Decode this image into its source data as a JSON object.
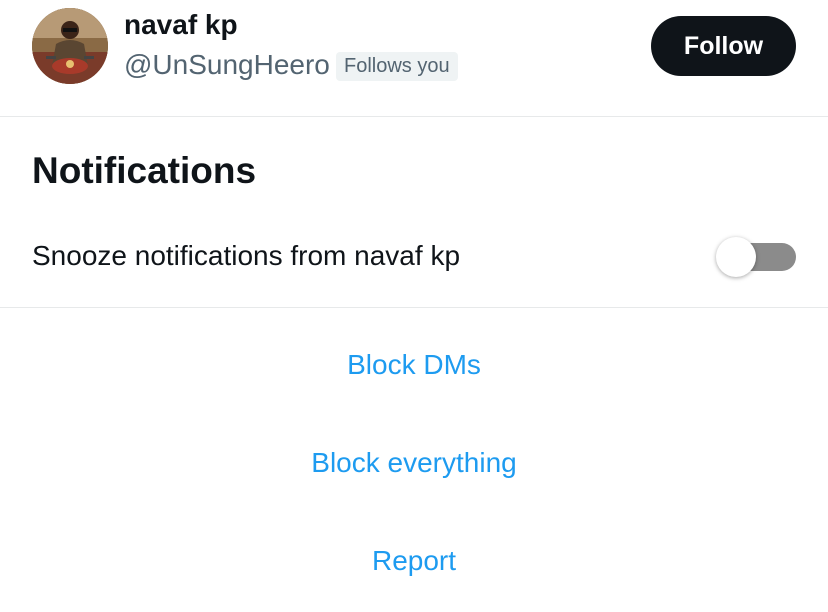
{
  "profile": {
    "name": "navaf kp",
    "handle": "@UnSungHeero",
    "follows_badge": "Follows you",
    "follow_label": "Follow"
  },
  "notifications": {
    "title": "Notifications",
    "snooze_label": "Snooze notifications from navaf kp",
    "snooze_enabled": false
  },
  "actions": {
    "block_dms": "Block DMs",
    "block_everything": "Block everything",
    "report": "Report"
  },
  "colors": {
    "link": "#1d9bf0",
    "follow_button": "#0f1419",
    "secondary_text": "#536471",
    "toggle_off_track": "#8b8b8b"
  },
  "icons": {
    "avatar": "profile-photo"
  }
}
